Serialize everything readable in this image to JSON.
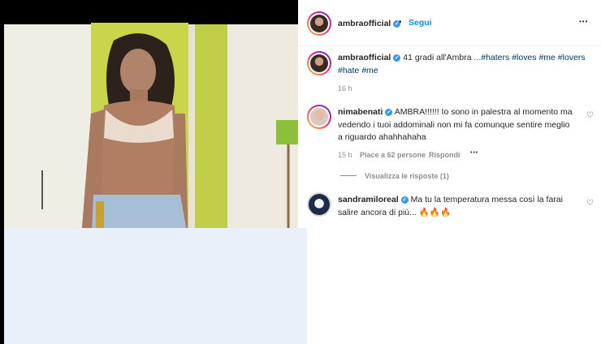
{
  "post": {
    "author": "ambraofficial",
    "follow_label": "Segui",
    "dot": "•",
    "more_label": "•••",
    "caption": {
      "text": "41 gradi all'Ambra ...",
      "tags": "#haters #loves #me #lovers",
      "tags2": "#hate #me"
    },
    "time": "16 h"
  },
  "comments": [
    {
      "user": "nimabenati",
      "line1": "AMBRA!!!!!! Io sono in palestra al momento ma",
      "line2": "vedendo i tuoi addominali non mi fa comunque sentire meglio",
      "line3": "a riguardo ahahhahaha",
      "time": "15 h",
      "likes": "Piace a 62 persone",
      "reply": "Rispondi",
      "more": "•••",
      "view_replies": "Visualizza le risposte (1)"
    },
    {
      "user": "sandramiloreal",
      "line1": "Ma tu la temperatura messa così la farai",
      "line2": "salire ancora di più... 🔥🔥🔥"
    }
  ],
  "icons": {
    "heart": "♡",
    "verified": "✓"
  },
  "colors": {
    "link_blue": "#0095f6",
    "verified_blue": "#3897f0",
    "wall_green": "#c6d64a",
    "overlay": "#eaf0fa"
  }
}
